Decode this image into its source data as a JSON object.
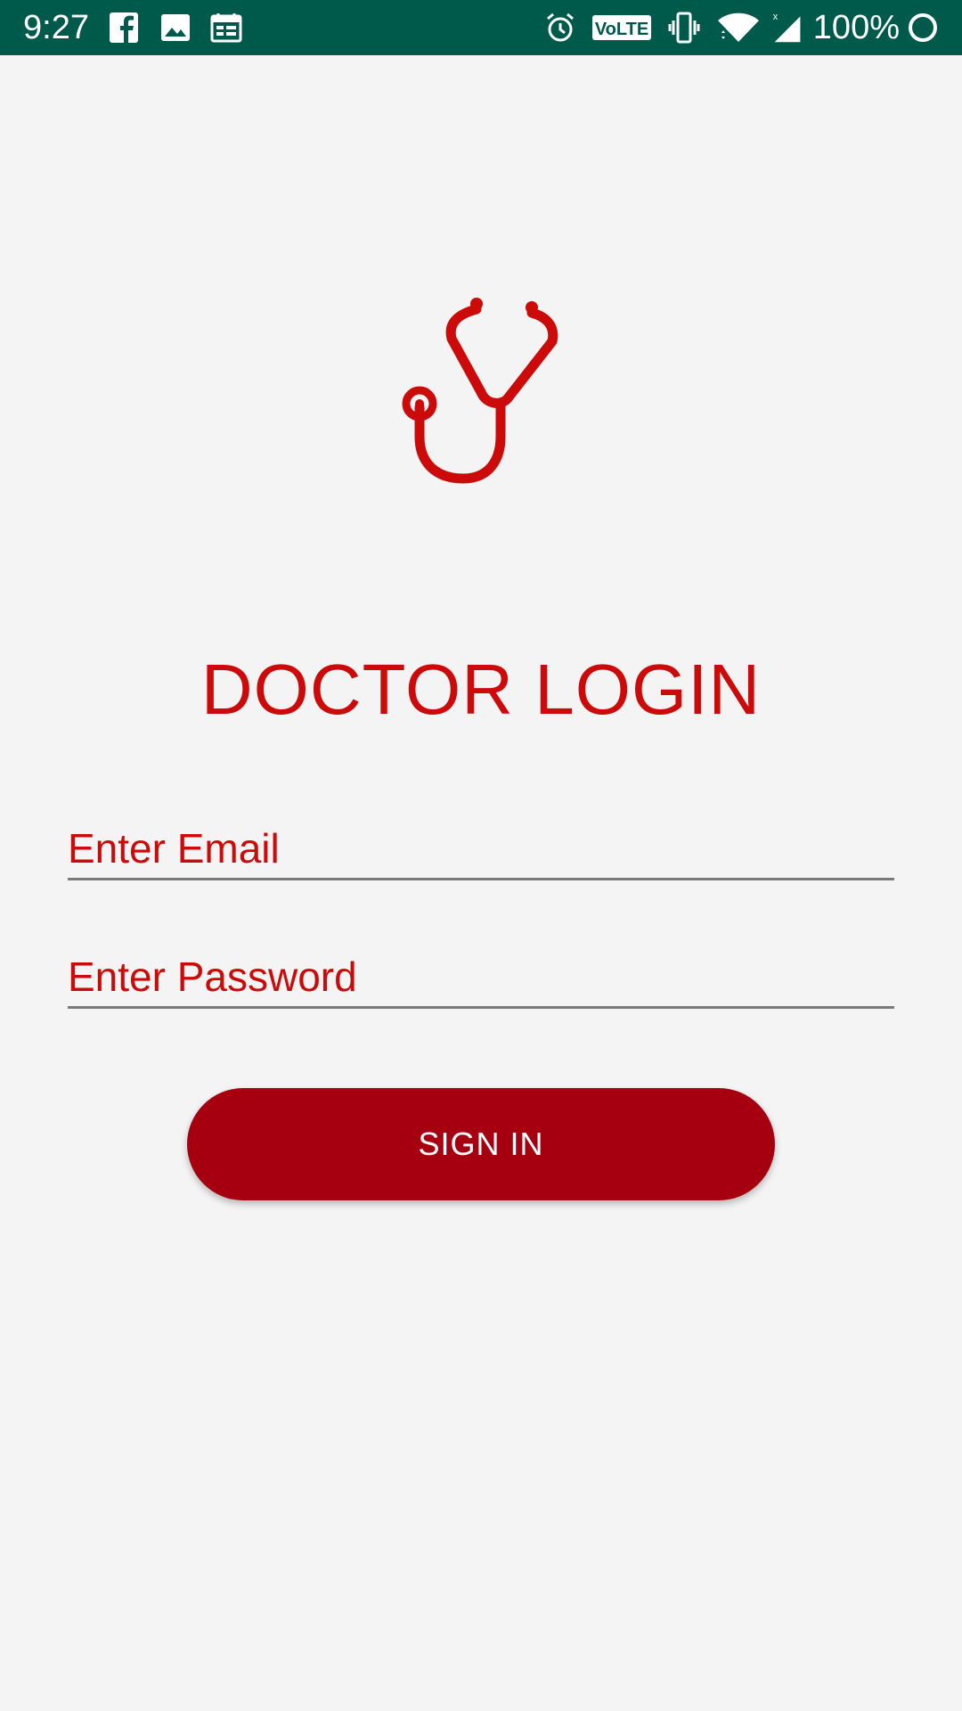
{
  "status_bar": {
    "time": "9:27",
    "battery": "100%",
    "volte_label": "VoLTE",
    "left_icons": [
      "facebook-icon",
      "image-icon",
      "calendar-icon"
    ],
    "right_icons": [
      "alarm-icon",
      "volte-icon",
      "vibrate-icon",
      "wifi-icon",
      "signal-icon",
      "battery-circle-icon"
    ],
    "background_color": "#005a4c"
  },
  "logo": {
    "icon": "stethoscope-icon",
    "color": "#cc0a0a"
  },
  "login": {
    "title": "DOCTOR LOGIN",
    "email_placeholder": "Enter Email",
    "email_value": "",
    "password_placeholder": "Enter Password",
    "password_value": "",
    "signin_label": "SIGN IN"
  },
  "colors": {
    "accent": "#cc0a0a",
    "button": "#a60010",
    "background": "#f4f4f4"
  }
}
